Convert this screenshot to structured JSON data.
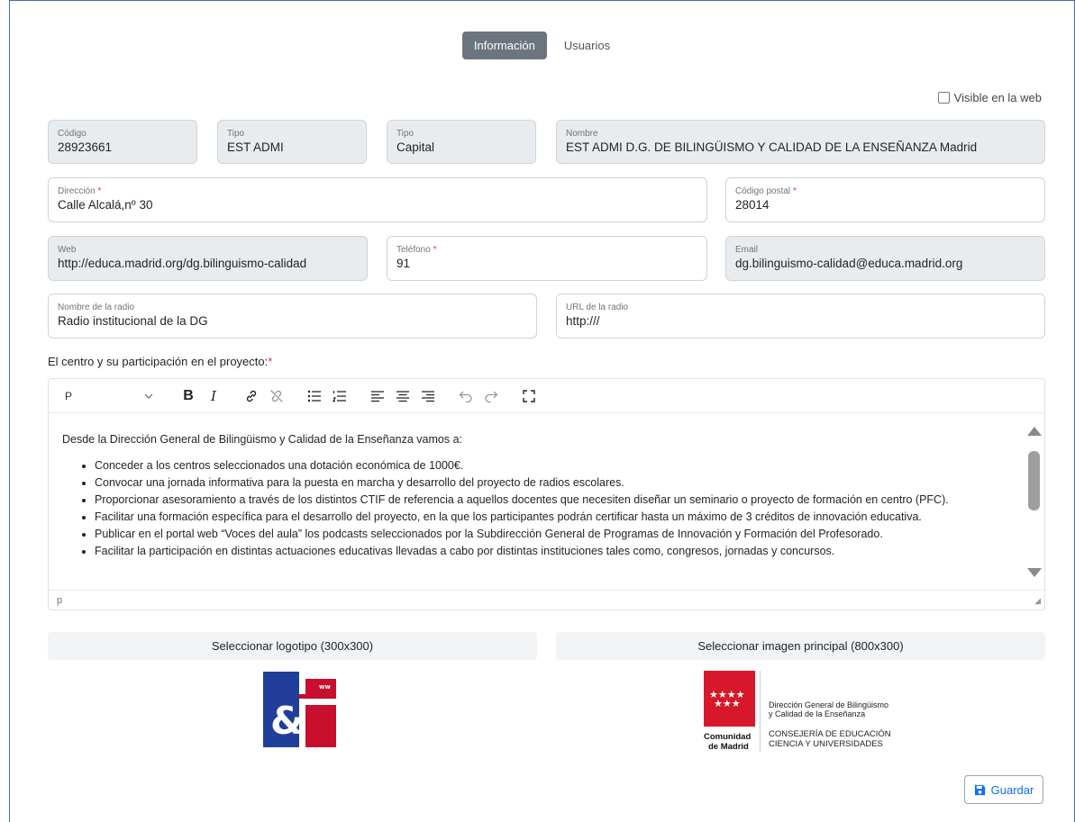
{
  "tabs": [
    {
      "label": "Información",
      "active": true
    },
    {
      "label": "Usuarios",
      "active": false
    }
  ],
  "visible_web": {
    "label": "Visible en la web",
    "checked": false
  },
  "fields": {
    "codigo": {
      "label": "Código",
      "value": "28923661"
    },
    "tipo1": {
      "label": "Tipo",
      "value": "EST ADMI"
    },
    "tipo2": {
      "label": "Tipo",
      "value": "Capital"
    },
    "nombre": {
      "label": "Nombre",
      "value": "EST ADMI D.G. DE BILINGÜISMO Y CALIDAD DE LA ENSEÑANZA Madrid"
    },
    "direccion": {
      "label": "Dirección",
      "value": "Calle Alcalá,nº 30"
    },
    "codigo_postal": {
      "label": "Código postal",
      "value": "28014"
    },
    "web": {
      "label": "Web",
      "value": "http://educa.madrid.org/dg.bilinguismo-calidad"
    },
    "telefono": {
      "label": "Teléfono",
      "value": "91"
    },
    "email": {
      "label": "Email",
      "value": "dg.bilinguismo-calidad@educa.madrid.org"
    },
    "nombre_radio": {
      "label": "Nombre de la radio",
      "value": "Radio institucional de la DG"
    },
    "url_radio": {
      "label": "URL de la radio",
      "value": "http:///"
    }
  },
  "required_mark": "*",
  "editor": {
    "section_label": "El centro y su participación en el proyecto:",
    "format_select": "P",
    "intro": "Desde la Dirección General de Bilingüismo y Calidad de la Enseñanza vamos a:",
    "items": [
      "Conceder a los centros seleccionados una dotación económica de 1000€.",
      "Convocar una jornada informativa para la puesta en marcha y desarrollo del proyecto de radios escolares.",
      "Proporcionar asesoramiento a través de los distintos CTIF de referencia a aquellos docentes que necesiten diseñar un seminario o proyecto de formación en centro (PFC).",
      "Facilitar una formación específica para el desarrollo del proyecto, en la que los participantes podrán certificar hasta un máximo de 3 créditos de innovación educativa.",
      "Publicar en el portal web “Voces del aula” los podcasts seleccionados por la Subdirección General de Programas de Innovación y Formación del Profesorado.",
      "Facilitar la participación en distintas actuaciones educativas llevadas a cabo por distintas instituciones tales como, congresos, jornadas y concursos."
    ],
    "status_path": "p"
  },
  "uploads": {
    "logo_label": "Seleccionar logotipo (300x300)",
    "image_label": "Seleccionar imagen principal (800x300)"
  },
  "logo2": {
    "line1": "Dirección General de Bilingüismo",
    "line2": "y Calidad de la Enseñanza",
    "line3": "CONSEJERÍA DE EDUCACIÓN",
    "line4": "CIENCIA Y UNIVERSIDADES",
    "brand1": "Comunidad",
    "brand2": "de Madrid"
  },
  "save_label": "Guardar",
  "colors": {
    "madrid_red": "#d7182a",
    "fse_blue": "#1f3f9b",
    "fse_red": "#c8102e",
    "primary": "#0d6efd"
  }
}
